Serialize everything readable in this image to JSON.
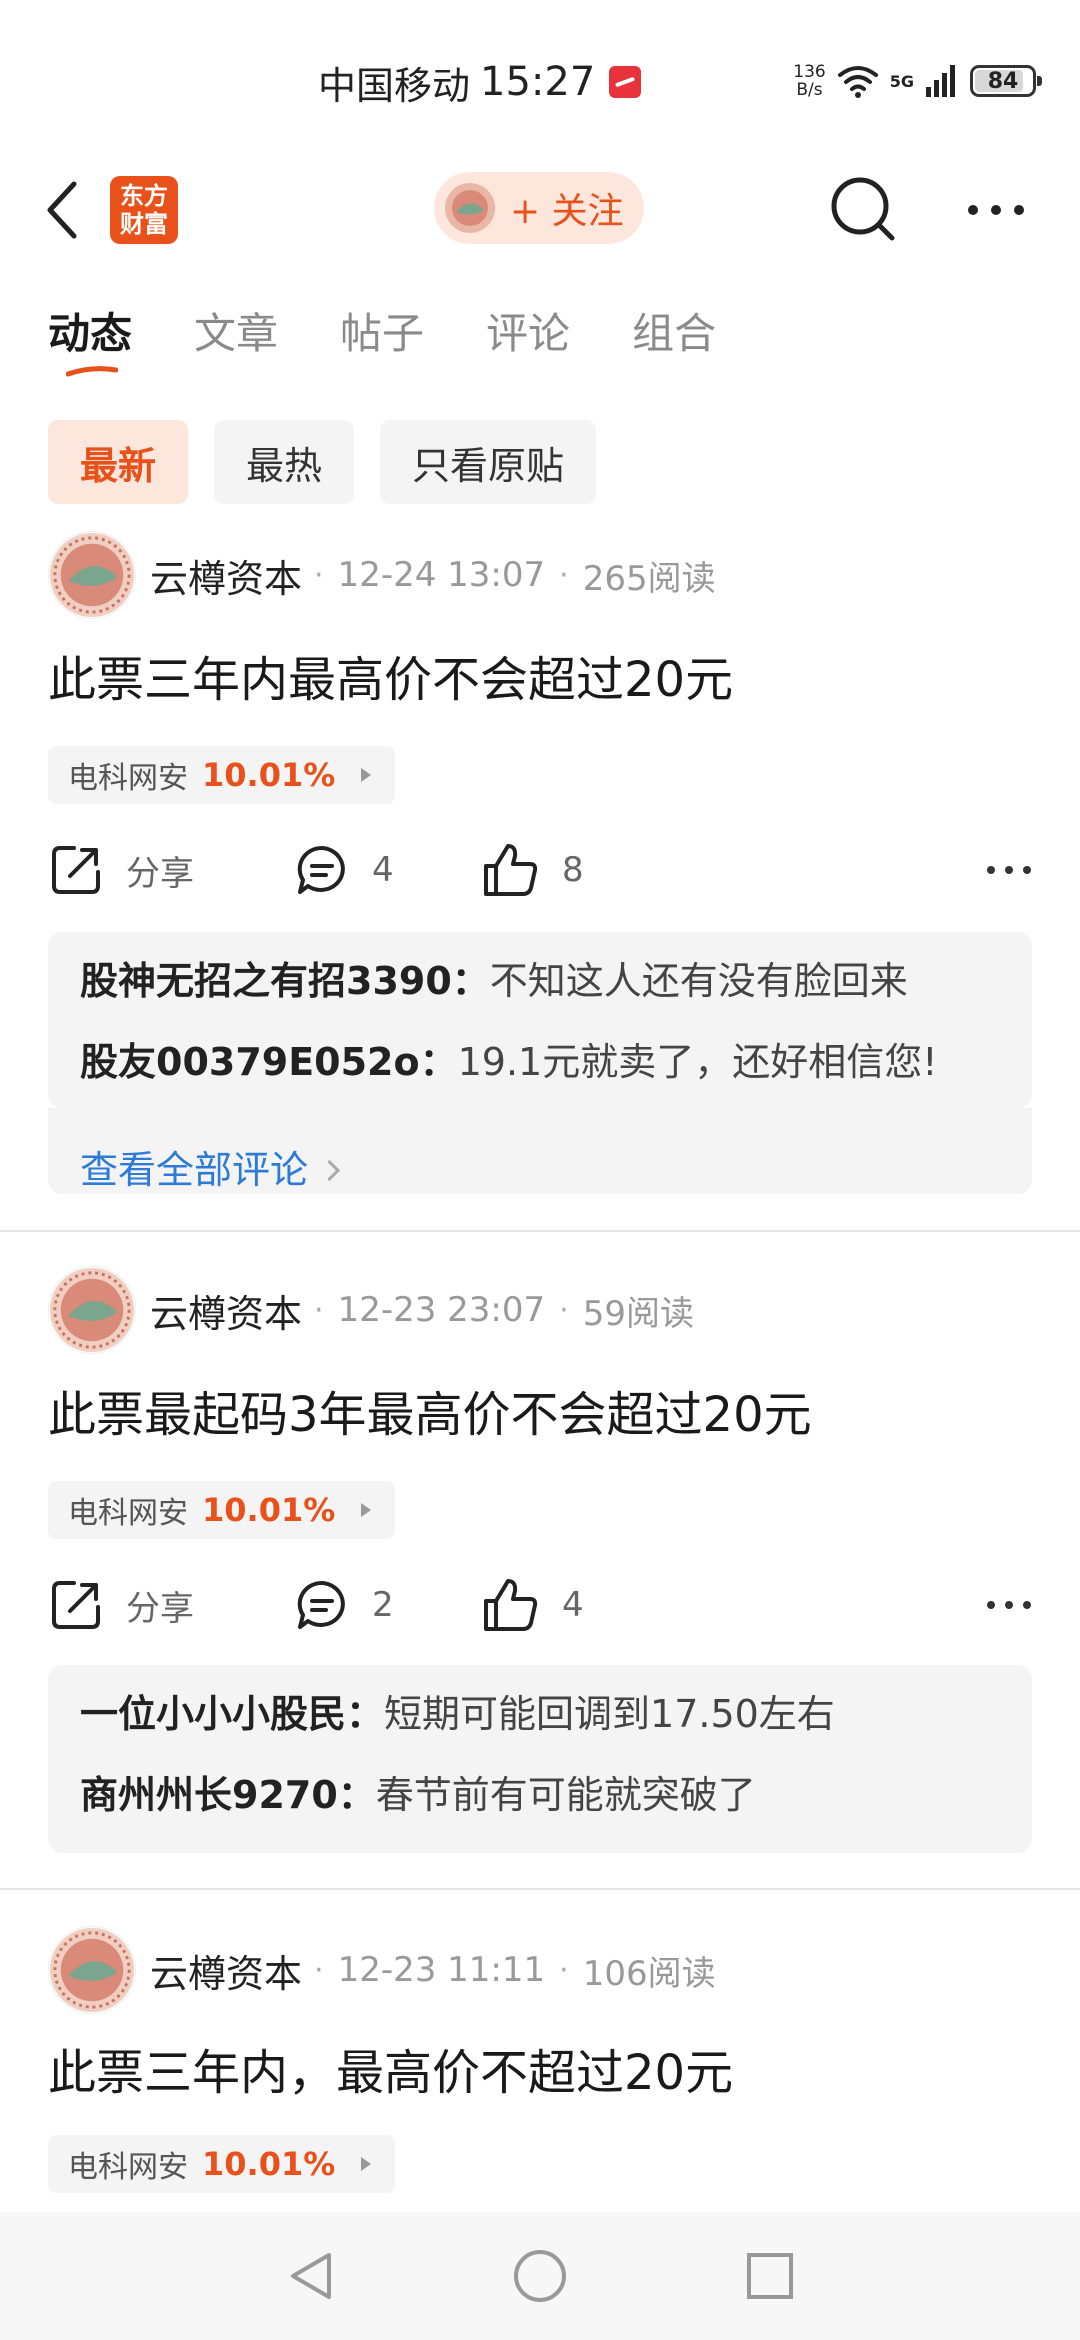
{
  "status_bar": {
    "carrier": "中国移动",
    "time": "15:27",
    "speed_value": "136",
    "speed_unit": "B/s",
    "network": "5G",
    "battery": "84"
  },
  "nav": {
    "logo_line1": "东方",
    "logo_line2": "财富",
    "follow_label": "+ 关注",
    "brand_color": "#e8511a"
  },
  "tabs": [
    "动态",
    "文章",
    "帖子",
    "评论",
    "组合"
  ],
  "filters": [
    "最新",
    "最热",
    "只看原贴"
  ],
  "posts": [
    {
      "author": "云樽资本",
      "time": "12-24 13:07",
      "reads": "265阅读",
      "title": "此票三年内最高价不会超过20元",
      "stock": {
        "name": "电科网安",
        "change": "10.01%"
      },
      "actions": {
        "share": "分享",
        "comments": "4",
        "likes": "8"
      },
      "comments": [
        {
          "user": "股神无招之有招3390：",
          "text": "不知这人还有没有脸回来"
        },
        {
          "user": "股友00379E052o：",
          "text": "19.1元就卖了，还好相信您!"
        }
      ],
      "view_all": "查看全部评论"
    },
    {
      "author": "云樽资本",
      "time": "12-23 23:07",
      "reads": "59阅读",
      "title": "此票最起码3年最高价不会超过20元",
      "stock": {
        "name": "电科网安",
        "change": "10.01%"
      },
      "actions": {
        "share": "分享",
        "comments": "2",
        "likes": "4"
      },
      "comments": [
        {
          "user": "一位小小小股民：",
          "text": "短期可能回调到17.50左右"
        },
        {
          "user": "商州州长9270：",
          "text": "春节前有可能就突破了"
        }
      ]
    },
    {
      "author": "云樽资本",
      "time": "12-23 11:11",
      "reads": "106阅读",
      "title": "此票三年内，最高价不超过20元",
      "stock": {
        "name": "电科网安",
        "change": "10.01%"
      }
    }
  ]
}
